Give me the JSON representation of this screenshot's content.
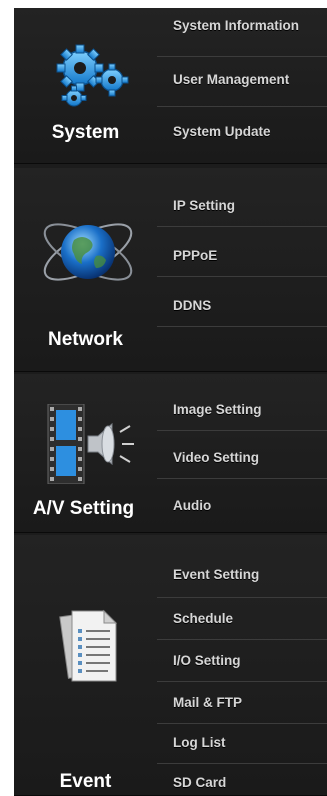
{
  "sections": [
    {
      "label": "System",
      "icon": "gears-icon",
      "items": [
        "System Information",
        "User Management",
        "System Update"
      ]
    },
    {
      "label": "Network",
      "icon": "globe-icon",
      "items": [
        "IP Setting",
        "PPPoE",
        "DDNS"
      ]
    },
    {
      "label": "A/V Setting",
      "icon": "film-speaker-icon",
      "items": [
        "Image Setting",
        "Video Setting",
        "Audio"
      ]
    },
    {
      "label": "Event",
      "icon": "document-list-icon",
      "items": [
        "Event Setting",
        "Schedule",
        "I/O Setting",
        "Mail & FTP",
        "Log List",
        "SD Card"
      ]
    }
  ],
  "colors": {
    "background": "#1c1c1c",
    "item_text": "#d6d6d6",
    "category_text": "#ffffff",
    "divider": "#3c3c3c"
  }
}
